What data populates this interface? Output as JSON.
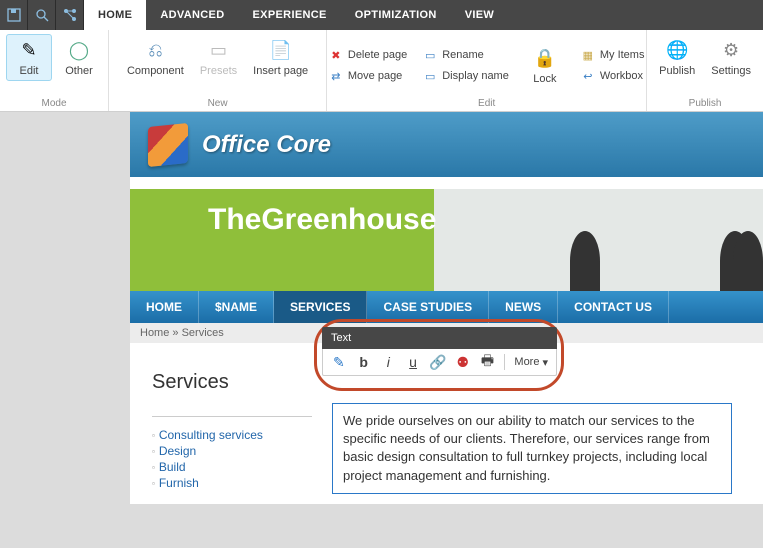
{
  "toolbar": {
    "save_icon": "save-icon",
    "search_icon": "search-icon",
    "tree_icon": "tree-icon"
  },
  "tabs": [
    "HOME",
    "ADVANCED",
    "EXPERIENCE",
    "OPTIMIZATION",
    "VIEW"
  ],
  "ribbon": {
    "mode": {
      "label": "Mode",
      "edit": "Edit",
      "other": "Other"
    },
    "new": {
      "label": "New",
      "component": "Component",
      "presets": "Presets",
      "insert_page": "Insert page"
    },
    "edit": {
      "label": "Edit",
      "delete": "Delete page",
      "rename": "Rename",
      "move": "Move page",
      "display_name": "Display name",
      "lock": "Lock",
      "my_items": "My Items",
      "workbox": "Workbox"
    },
    "publish": {
      "label": "Publish",
      "publish": "Publish",
      "settings": "Settings"
    }
  },
  "brand": {
    "name": "Office Core"
  },
  "banner": {
    "text": "TheGreenhouse"
  },
  "nav": [
    "HOME",
    "$NAME",
    "SERVICES",
    "CASE STUDIES",
    "NEWS",
    "CONTACT US"
  ],
  "breadcrumb": {
    "home": "Home",
    "sep": " » ",
    "current": "Services"
  },
  "side": {
    "title": "Services",
    "items": [
      "Consulting services",
      "Design",
      "Build",
      "Furnish"
    ]
  },
  "popup": {
    "title": "Text",
    "more": "More"
  },
  "editable_text": "We pride ourselves on our ability to match our services to the specific needs of our clients. Therefore, our services range from basic design consultation to full turnkey projects, including local project management and furnishing."
}
